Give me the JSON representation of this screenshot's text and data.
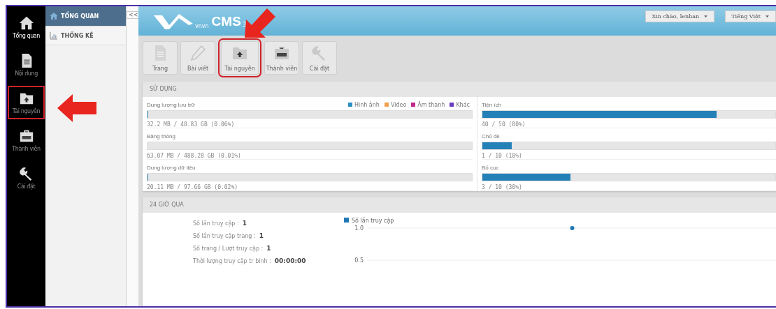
{
  "sidebar": {
    "items": [
      {
        "label": "Tổng quan",
        "selected": true,
        "highlighted": false
      },
      {
        "label": "Nội dung",
        "selected": false,
        "highlighted": false
      },
      {
        "label": "Tài nguyên",
        "selected": false,
        "highlighted": true
      },
      {
        "label": "Thành viên",
        "selected": false,
        "highlighted": false
      },
      {
        "label": "Cài đặt",
        "selected": false,
        "highlighted": false
      }
    ]
  },
  "subnav": {
    "items": [
      {
        "label": "TỔNG QUAN",
        "selected": true
      },
      {
        "label": "THỐNG KÊ",
        "selected": false
      }
    ]
  },
  "collapse_button": "<<",
  "header": {
    "logo_small": "vnvn",
    "logo_text": "CMS",
    "logo_version": "3",
    "user_menu": "Xin chào, lenhan",
    "language_menu": "Tiếng Việt"
  },
  "toolbar": {
    "buttons": [
      {
        "label": "Trang",
        "highlighted": false
      },
      {
        "label": "Bài viết",
        "highlighted": false
      },
      {
        "label": "Tài nguyên",
        "highlighted": true
      },
      {
        "label": "Thành viên",
        "highlighted": false
      },
      {
        "label": "Cài đặt",
        "highlighted": false
      }
    ]
  },
  "usage": {
    "title": "SỬ DỤNG",
    "legend": [
      {
        "label": "Hình ảnh",
        "color": "#2a8ec4"
      },
      {
        "label": "Video",
        "color": "#f0a050"
      },
      {
        "label": "Âm thanh",
        "color": "#c0288a"
      },
      {
        "label": "Khác",
        "color": "#6a3cc0"
      }
    ],
    "left": [
      {
        "label": "Dung lượng lưu trữ",
        "level": 0.0006,
        "reading": "32.2 MB / 48.83 GB (0.06%)"
      },
      {
        "label": "Băng thông",
        "level": 0.0001,
        "reading": "63.07 MB / 488.28 GB (0.01%)"
      },
      {
        "label": "Dung lượng dữ liệu",
        "level": 0.0002,
        "reading": "20.11 MB / 97.66 GB (0.02%)"
      }
    ],
    "right": [
      {
        "label": "Tiện ích",
        "level": 0.8,
        "reading": "40 / 50 (80%)"
      },
      {
        "label": "Chủ đề",
        "level": 0.1,
        "reading": "1 / 10 (10%)"
      },
      {
        "label": "Bố cục",
        "level": 0.3,
        "reading": "3 / 10 (30%)"
      }
    ]
  },
  "last_24h": {
    "title": "24 GIỜ QUA",
    "stats": [
      {
        "label": "Số lần truy cập :",
        "value": "1"
      },
      {
        "label": "Số lần truy cập trang :",
        "value": "1"
      },
      {
        "label": "Số trang / Lượt truy cập :",
        "value": "1"
      },
      {
        "label": "Thời lượng truy cập tr bình :",
        "value": "00:00:00"
      }
    ],
    "chart_data": {
      "type": "line",
      "series": [
        {
          "name": "Số lần truy cập",
          "color": "#1f78b4",
          "marker": "o",
          "values": [
            1
          ]
        }
      ],
      "ylim": [
        0.5,
        1
      ],
      "yticks": [
        {
          "value": 1,
          "label": "1.0"
        },
        {
          "value": 0.5,
          "label": "0.5"
        }
      ]
    }
  }
}
